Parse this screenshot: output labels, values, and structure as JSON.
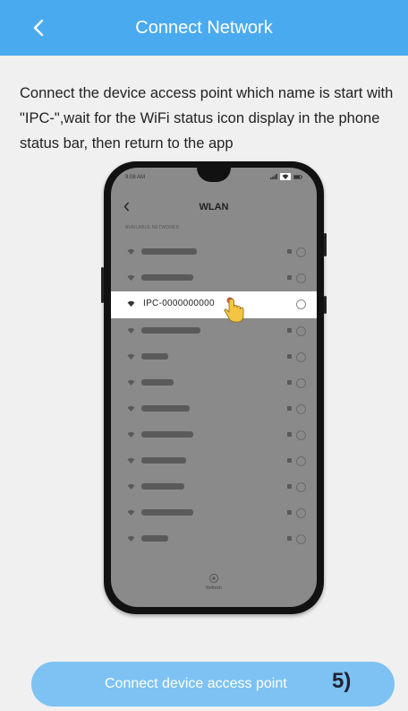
{
  "header": {
    "title": "Connect Network",
    "back_icon": "chevron-left-icon",
    "background_color": "#4aaaf0"
  },
  "instructions": "Connect the device access point which name is start with \"IPC-\",wait for the WiFi status icon display in the phone status bar, then return to the app",
  "phone": {
    "status_time": "9:06 AM",
    "nav_title": "WLAN",
    "section_label": "AVAILABLE NETWORKS",
    "highlighted_network": "IPC-0000000000",
    "bottom_nav_label": "Refresh"
  },
  "action_button": {
    "label": "Connect device access point",
    "step_mark": "5)",
    "color": "#7dc2f2"
  }
}
